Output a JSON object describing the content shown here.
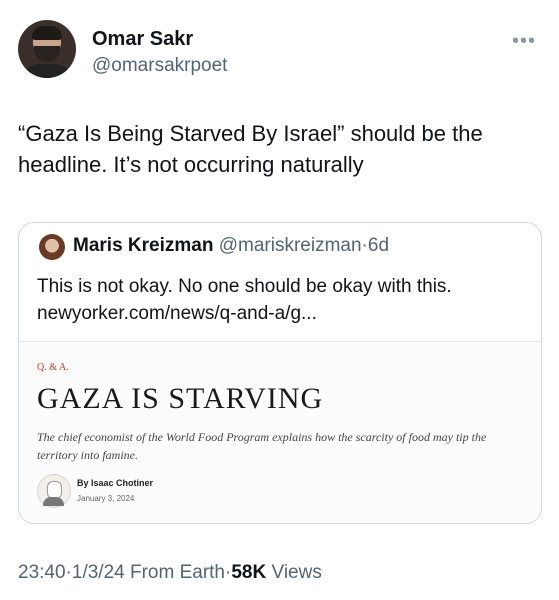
{
  "tweet": {
    "author_name": "Omar Sakr",
    "author_handle": "@omarsakrpoet",
    "more_label": "•••",
    "text": "“Gaza Is Being Starved By Israel” should be the headline. It’s not occurring naturally"
  },
  "quoted": {
    "author_name": "Maris Kreizman",
    "author_handle": "@mariskreizman",
    "separator": "·",
    "age": "6d",
    "text_line1": "This is not okay. No one should be okay with this.",
    "text_line2": "newyorker.com/news/q-and-a/g...",
    "card": {
      "kicker": "Q. & A.",
      "headline": "GAZA IS STARVING",
      "dek": "The chief economist of the World Food Program explains how the scarcity of food may tip the territory into famine.",
      "byline": "By Isaac Chotiner",
      "date": "January 3, 2024"
    }
  },
  "footer": {
    "time": "23:40",
    "date": "1/3/24",
    "source": "From Earth",
    "views_count": "58K",
    "views_label": "Views",
    "separator": "·"
  }
}
